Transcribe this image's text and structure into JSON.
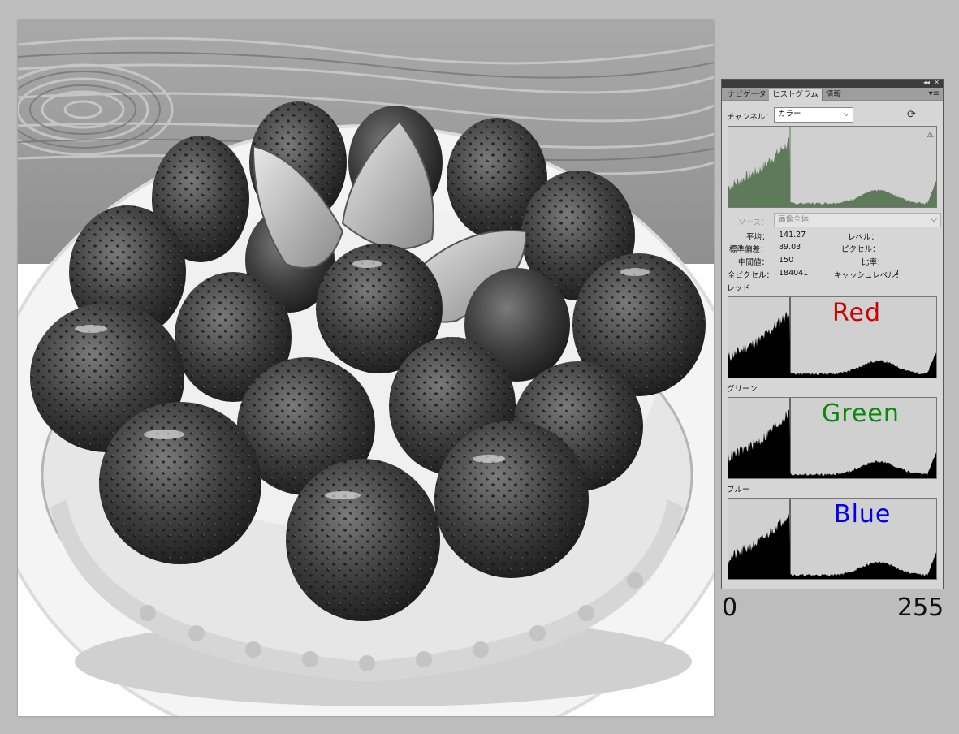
{
  "panel": {
    "titlebar_controls": {
      "collapse": "◂◂",
      "close": "✕"
    },
    "tabs": [
      {
        "label": "ナビゲータ",
        "active": false
      },
      {
        "label": "ヒストグラム",
        "active": true
      },
      {
        "label": "情報",
        "active": false
      }
    ],
    "menu_icon": "panel-menu-icon",
    "channel_label": "チャンネル：",
    "channel_value": "カラー",
    "refresh_icon": "refresh-icon",
    "warning_icon": "warning-icon",
    "source_label": "ソース：",
    "source_value": "画像全体",
    "stats": {
      "mean_label": "平均：",
      "mean_value": "141.27",
      "stddev_label": "標準偏差：",
      "stddev_value": "89.03",
      "median_label": "中間値：",
      "median_value": "150",
      "pixels_label": "全ピクセル：",
      "pixels_value": "184041",
      "level_label": "レベル：",
      "count_label": "ピクセル：",
      "percentile_label": "比率：",
      "cache_label": "キャッシュレベル：",
      "cache_value": "2"
    },
    "channels": [
      {
        "label": "レッド",
        "overlay": "Red",
        "color": "#cc0000"
      },
      {
        "label": "グリーン",
        "overlay": "Green",
        "color": "#0a8a0a"
      },
      {
        "label": "ブルー",
        "overlay": "Blue",
        "color": "#0000ee"
      }
    ],
    "composite_color": "#5f7a5a"
  },
  "scale": {
    "min": "0",
    "max": "255"
  }
}
